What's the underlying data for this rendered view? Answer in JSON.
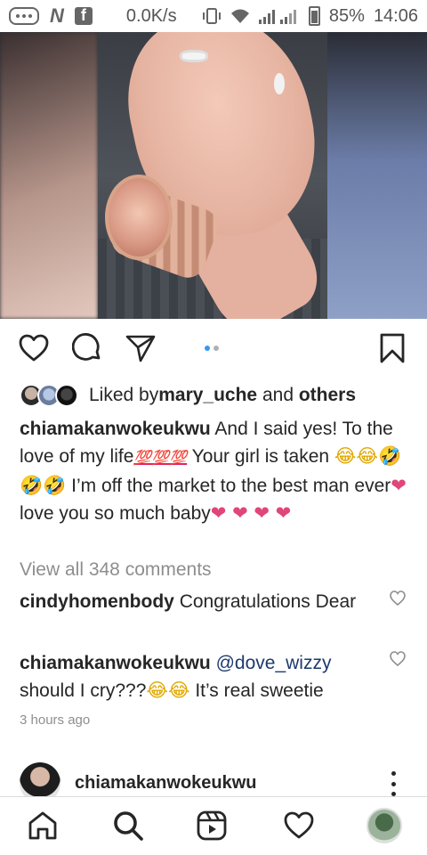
{
  "status_bar": {
    "network_speed": "0.0K/s",
    "battery": "85%",
    "time": "14:06",
    "left_icons": [
      "message-icon",
      "n-app-icon",
      "facebook-icon"
    ],
    "right_icons": [
      "vibrate-icon",
      "wifi-icon",
      "signal-icon",
      "battery-icon"
    ]
  },
  "post": {
    "media": {
      "description_icon": "photo",
      "carousel_count": 2,
      "carousel_active": 1
    },
    "actions": {
      "like_icon": "heart-icon",
      "comment_icon": "comment-icon",
      "share_icon": "send-icon",
      "save_icon": "bookmark-icon"
    },
    "likes": {
      "prefix": "Liked by ",
      "user": "mary_uche",
      "joiner": " and ",
      "others": "others"
    },
    "caption": {
      "username": "chiamakanwokeukwu",
      "text_1": " And I said yes! To the love of my life",
      "emoji_100": "💯💯💯",
      "text_2": " Your girl is taken ",
      "emoji_laugh": "😂😂🤣🤣🤣",
      "text_3": " I’m off the market to the best man ever",
      "emoji_heart_1": "❤",
      "text_4": " love you so much baby",
      "emoji_hearts_2": "❤ ❤ ❤ ❤"
    },
    "view_comments": "View all 348 comments",
    "comments": [
      {
        "username": "cindyhomenbody",
        "text": " Congratulations Dear"
      },
      {
        "username": "chiamakanwokeukwu",
        "mention": "@dove_wizzy",
        "text": " should I cry???",
        "emoji": "😂😂",
        "text_after": " It’s real sweetie"
      }
    ],
    "timestamp": "3 hours ago"
  },
  "next_post": {
    "username": "chiamakanwokeukwu"
  },
  "bottom_nav": {
    "items": [
      "home-icon",
      "search-icon",
      "reels-icon",
      "activity-heart-icon",
      "profile-avatar"
    ]
  }
}
